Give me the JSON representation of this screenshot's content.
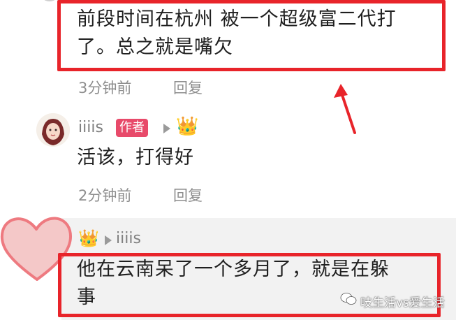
{
  "comment1": {
    "text_line1": "前段时间在杭州 被一个超级富二代打",
    "text_line2": "了。总之就是嘴欠",
    "time": "3分钟前",
    "reply_label": "回复"
  },
  "comment2": {
    "username": "iiiis",
    "badge": "作者",
    "crown_icon": "👑",
    "text": "活该，打得好",
    "time": "2分钟前",
    "reply_label": "回复"
  },
  "reply": {
    "crown_icon": "👑",
    "target_username": "iiiis",
    "text_line1": "他在云南呆了一个多月了，就是在躲",
    "text_line2": "事"
  },
  "watermark": {
    "text": "吱生活vs爱生活"
  },
  "colors": {
    "highlight_red": "#e8242a",
    "badge_pink": "#e84a6a",
    "meta_gray": "#8e8e8e"
  }
}
